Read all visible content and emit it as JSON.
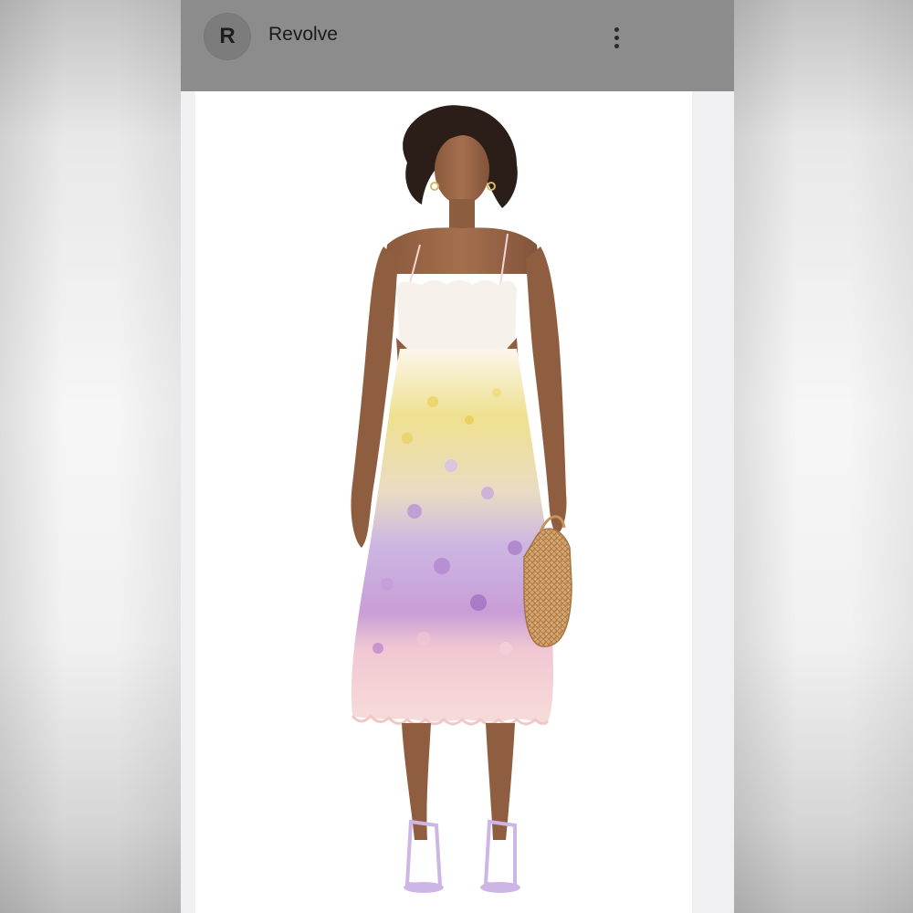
{
  "header": {
    "avatar_letter": "R",
    "title": "Revolve",
    "menu_icon": "kebab-vertical-icon"
  },
  "product": {
    "image_icon": "product-photo",
    "colors": {
      "topbar": "#8c8c8c",
      "dress_bodice": "#f6f1ea",
      "floral_yellow": "#e8d46a",
      "floral_lilac": "#b99bd6",
      "floral_pink": "#f3c9cf",
      "hem_blush": "#f6d9d8",
      "sandals": "#cdb6e6",
      "bag": "#d6a76c",
      "skin": "#9a6646",
      "hair": "#2b1d17"
    }
  }
}
